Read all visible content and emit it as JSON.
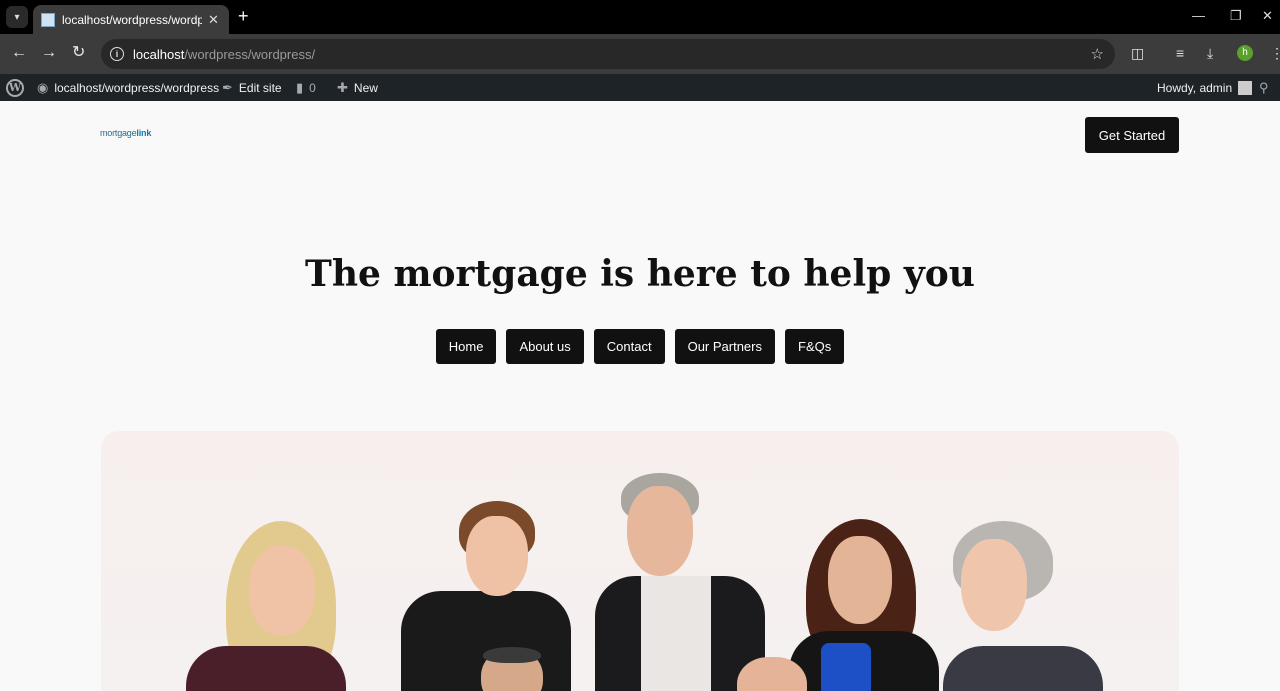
{
  "browser": {
    "tab_title": "localhost/wordpress/wordpress",
    "url_host": "localhost",
    "url_path": "/wordpress/wordpress/",
    "profile_initial": "h"
  },
  "adminbar": {
    "site": "localhost/wordpress/wordpress",
    "edit_site": "Edit site",
    "comments": "0",
    "new": "New",
    "howdy": "Howdy, admin"
  },
  "header": {
    "logo_text_plain": "mortgage",
    "logo_text_bold": "link",
    "cta": "Get Started"
  },
  "hero": {
    "title": "The mortgage is here to help you"
  },
  "nav": {
    "items": [
      "Home",
      "About us",
      "Contact",
      "Our Partners",
      "F&Qs"
    ]
  }
}
